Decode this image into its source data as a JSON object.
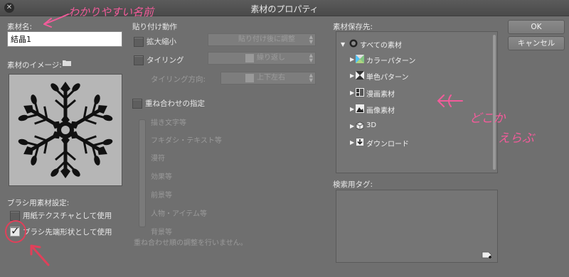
{
  "window": {
    "title": "素材のプロパティ"
  },
  "left": {
    "name_label": "素材名:",
    "name_value": "結晶1",
    "image_label": "素材のイメージ:",
    "brush_settings_label": "ブラシ用素材設定:",
    "paper_texture_label": "用紙テクスチャとして使用",
    "paper_texture_checked": false,
    "brush_tip_label": "ブラシ先端形状として使用",
    "brush_tip_checked": true
  },
  "paste": {
    "header": "貼り付け動作",
    "scale_label": "拡大縮小",
    "scale_select": "貼り付け後に調整",
    "tiling_label": "タイリング",
    "tiling_select": "繰り返し",
    "tiling_direction_label": "タイリング方向:",
    "tiling_direction_select": "上下左右",
    "overlay_label": "重ね合わせの指定",
    "overlay_items": [
      "描き文字等",
      "フキダシ・テキスト等",
      "漫符",
      "効果等",
      "前景等",
      "人物・アイテム等",
      "背景等"
    ],
    "overlay_note": "重ね合わせ順の調整を行いません。"
  },
  "right": {
    "save_label": "素材保存先:",
    "tree": [
      {
        "label": "すべての素材",
        "icon": "all-materials-icon"
      },
      {
        "label": "カラーパターン",
        "icon": "color-pattern-icon"
      },
      {
        "label": "単色パターン",
        "icon": "mono-pattern-icon"
      },
      {
        "label": "漫画素材",
        "icon": "manga-material-icon"
      },
      {
        "label": "画像素材",
        "icon": "image-material-icon"
      },
      {
        "label": "3D",
        "icon": "3d-icon"
      },
      {
        "label": "ダウンロード",
        "icon": "download-icon"
      }
    ],
    "search_tag_label": "検索用タグ:"
  },
  "buttons": {
    "ok": "OK",
    "cancel": "キャンセル"
  },
  "annotations": {
    "name_note": "わかりやすい名前",
    "choose_note_1": "どこか",
    "choose_note_2": "えらぶ",
    "color": "#f25c9a"
  },
  "colors": {
    "background": "#6f6f6f",
    "panel": "#757575",
    "annotation": "#f25c9a"
  }
}
